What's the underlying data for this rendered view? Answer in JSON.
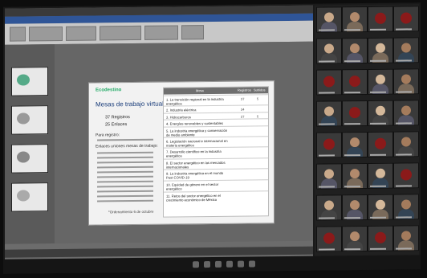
{
  "app": {
    "ribbon_icons": [
      "paste-icon",
      "font-icon",
      "paragraph-icon",
      "shapes-icon",
      "arrange-icon",
      "find-icon"
    ]
  },
  "slide": {
    "logo_text": "Ecodestino",
    "title": "Mesas de trabajo virtual*",
    "stats": [
      "37 Registros",
      "25 Enlaces"
    ],
    "registered_label": "Para registro:",
    "links_label": "Enlaces uniones mesas de trabajo:",
    "footer": "*Ordenamiento 6 de octubre",
    "table": {
      "headers": [
        "Mesa",
        "Registros",
        "Subidos"
      ],
      "rows": [
        {
          "label": "1. La transición regional en la industria energética",
          "registros": "37",
          "subidos": "5"
        },
        {
          "label": "2. Industria eléctrica",
          "registros": "34",
          "subidos": ""
        },
        {
          "label": "3. Hidrocarburos",
          "registros": "27",
          "subidos": "5"
        },
        {
          "label": "4. Energías renovables y sustentables",
          "registros": "",
          "subidos": ""
        },
        {
          "label": "5. La industria energética y conservación de medio ambiente",
          "registros": "",
          "subidos": ""
        },
        {
          "label": "6. Legislación nacional e internacional en materia energética",
          "registros": "",
          "subidos": ""
        },
        {
          "label": "7. Desarrollo científico en la industria energética",
          "registros": "",
          "subidos": ""
        },
        {
          "label": "8. El sector energético en las mercados internacionales",
          "registros": "",
          "subidos": ""
        },
        {
          "label": "9. La industria energética en el mundo Post COVID-19",
          "registros": "",
          "subidos": ""
        },
        {
          "label": "10. Equidad de género en el sector energético",
          "registros": "",
          "subidos": ""
        },
        {
          "label": "11. Retos del sector energético en el crecimiento económico de México",
          "registros": "",
          "subidos": ""
        }
      ]
    }
  },
  "participants": {
    "count": 32
  },
  "colors": {
    "ribbon_blue": "#2f5597",
    "avatar_red": "#8b1a1a"
  }
}
